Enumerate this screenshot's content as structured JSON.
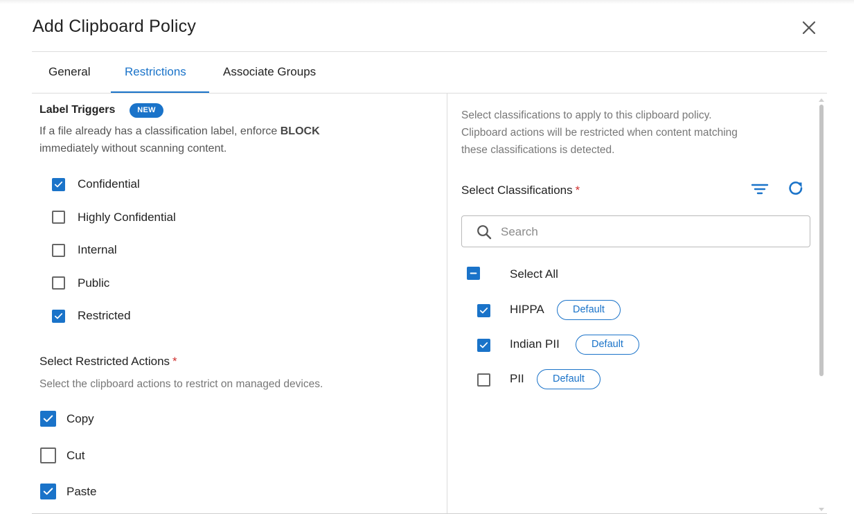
{
  "dialog": {
    "title": "Add Clipboard Policy"
  },
  "tabs": [
    {
      "label": "General",
      "active": false
    },
    {
      "label": "Restrictions",
      "active": true
    },
    {
      "label": "Associate Groups",
      "active": false
    }
  ],
  "label_triggers": {
    "title": "Label Triggers",
    "badge": "NEW",
    "description_pre": "If a file already has a classification label, enforce ",
    "description_bold": "BLOCK",
    "description_post": "immediately without scanning content.",
    "options": [
      {
        "label": "Confidential",
        "checked": true
      },
      {
        "label": "Highly Confidential",
        "checked": false
      },
      {
        "label": "Internal",
        "checked": false
      },
      {
        "label": "Public",
        "checked": false
      },
      {
        "label": "Restricted",
        "checked": true
      }
    ]
  },
  "restricted_actions": {
    "title": "Select Restricted Actions",
    "required_mark": "*",
    "hint": "Select the clipboard actions to restrict on managed devices.",
    "options": [
      {
        "label": "Copy",
        "checked": true
      },
      {
        "label": "Cut",
        "checked": false
      },
      {
        "label": "Paste",
        "checked": true
      }
    ]
  },
  "classifications": {
    "description_line1": "Select classifications to apply to this clipboard policy.",
    "description_line2": "Clipboard actions will be restricted when content matching",
    "description_line3": "these classifications is detected.",
    "title": "Select Classifications",
    "required_mark": "*",
    "search_placeholder": "Search",
    "search_value": "",
    "select_all_label": "Select All",
    "select_all_state": "indeterminate",
    "items": [
      {
        "label": "HIPPA",
        "checked": true,
        "tag": "Default"
      },
      {
        "label": "Indian PII",
        "checked": true,
        "tag": "Default"
      },
      {
        "label": "PII",
        "checked": false,
        "tag": "Default"
      }
    ]
  },
  "colors": {
    "accent": "#1a73c9",
    "required": "#d0302f",
    "border": "#dcdcdc"
  },
  "icons": {
    "close": "close-icon",
    "filter": "filter-icon",
    "refresh": "refresh-icon",
    "search": "search-icon",
    "check": "check-icon",
    "minus": "minus-icon"
  }
}
